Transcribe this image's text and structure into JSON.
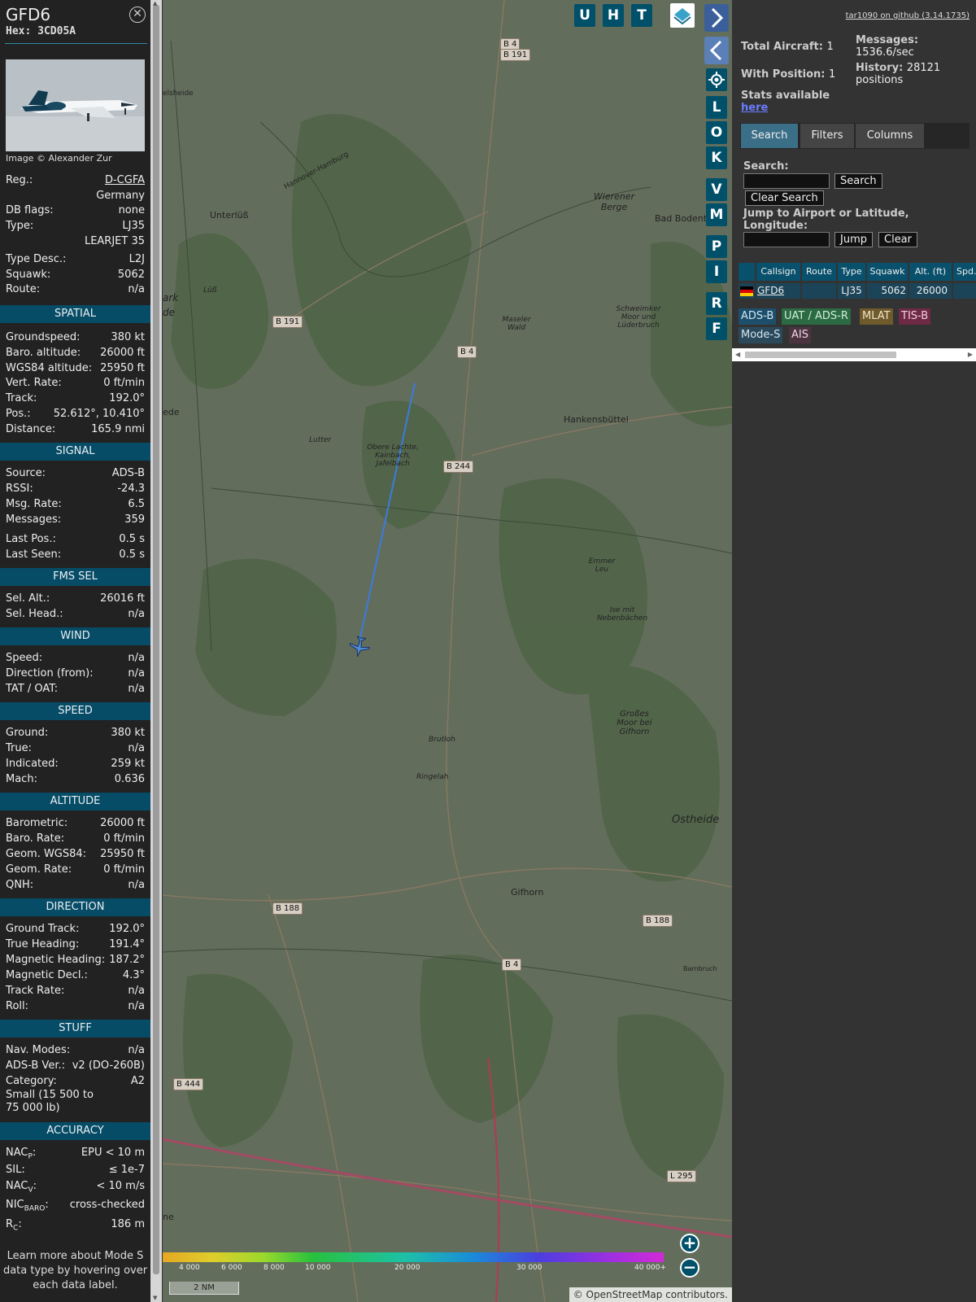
{
  "aircraft": {
    "callsign": "GFD6",
    "hex_label": "Hex:",
    "hex": "3CD05A",
    "image_credit": "Image © Alexander Zur"
  },
  "info": {
    "reg_label": "Reg.:",
    "reg": "D-CGFA",
    "country": "Germany",
    "dbflags_label": "DB flags:",
    "dbflags": "none",
    "type_label": "Type:",
    "type": "LJ35",
    "type_name": "LEARJET 35",
    "typedesc_label": "Type Desc.:",
    "typedesc": "L2J",
    "squawk_label": "Squawk:",
    "squawk": "5062",
    "route_label": "Route:",
    "route": "n/a"
  },
  "spatial": {
    "title": "SPATIAL",
    "rows": [
      {
        "k": "Groundspeed:",
        "v": "380 kt"
      },
      {
        "k": "Baro. altitude:",
        "v": "26000 ft"
      },
      {
        "k": "WGS84 altitude:",
        "v": "25950 ft"
      },
      {
        "k": "Vert. Rate:",
        "v": "0 ft/min"
      },
      {
        "k": "Track:",
        "v": "192.0°"
      },
      {
        "k": "Pos.:",
        "v": "52.612°, 10.410°"
      },
      {
        "k": "Distance:",
        "v": "165.9 nmi"
      }
    ]
  },
  "signal": {
    "title": "SIGNAL",
    "rows": [
      {
        "k": "Source:",
        "v": "ADS-B"
      },
      {
        "k": "RSSI:",
        "v": "-24.3"
      },
      {
        "k": "Msg. Rate:",
        "v": "6.5"
      },
      {
        "k": "Messages:",
        "v": "359"
      },
      {
        "k": "Last Pos.:",
        "v": "0.5 s"
      },
      {
        "k": "Last Seen:",
        "v": "0.5 s"
      }
    ]
  },
  "fms": {
    "title": "FMS SEL",
    "rows": [
      {
        "k": "Sel. Alt.:",
        "v": "26016 ft"
      },
      {
        "k": "Sel. Head.:",
        "v": "n/a"
      }
    ]
  },
  "wind": {
    "title": "WIND",
    "rows": [
      {
        "k": "Speed:",
        "v": "n/a"
      },
      {
        "k": "Direction (from):",
        "v": "n/a"
      },
      {
        "k": "TAT / OAT:",
        "v": "n/a"
      }
    ]
  },
  "speed": {
    "title": "SPEED",
    "rows": [
      {
        "k": "Ground:",
        "v": "380 kt"
      },
      {
        "k": "True:",
        "v": "n/a"
      },
      {
        "k": "Indicated:",
        "v": "259 kt"
      },
      {
        "k": "Mach:",
        "v": "0.636"
      }
    ]
  },
  "altitude": {
    "title": "ALTITUDE",
    "rows": [
      {
        "k": "Barometric:",
        "v": "26000 ft"
      },
      {
        "k": "Baro. Rate:",
        "v": "0 ft/min"
      },
      {
        "k": "Geom. WGS84:",
        "v": "25950 ft"
      },
      {
        "k": "Geom. Rate:",
        "v": "0 ft/min"
      },
      {
        "k": "QNH:",
        "v": "n/a"
      }
    ]
  },
  "direction": {
    "title": "DIRECTION",
    "rows": [
      {
        "k": "Ground Track:",
        "v": "192.0°"
      },
      {
        "k": "True Heading:",
        "v": "191.4°"
      },
      {
        "k": "Magnetic Heading:",
        "v": "187.2°"
      },
      {
        "k": "Magnetic Decl.:",
        "v": "4.3°"
      },
      {
        "k": "Track Rate:",
        "v": "n/a"
      },
      {
        "k": "Roll:",
        "v": "n/a"
      }
    ]
  },
  "stuff": {
    "title": "STUFF",
    "rows": [
      {
        "k": "Nav. Modes:",
        "v": "n/a"
      },
      {
        "k": "ADS-B Ver.:",
        "v": "v2 (DO-260B)"
      },
      {
        "k": "Category:",
        "v": "A2"
      }
    ],
    "category_desc_1": "Small (15 500 to",
    "category_desc_2": "75 000 lb)"
  },
  "accuracy": {
    "title": "ACCURACY",
    "nacp_label": "NAC",
    "nacp_sub": "P",
    "nacp": "EPU < 10 m",
    "sil_label": "SIL:",
    "sil": "≤ 1e-7",
    "nacv_label": "NAC",
    "nacv_sub": "V",
    "nacv": "< 10 m/s",
    "nicbaro_label": "NIC",
    "nicbaro_sub": "BARO",
    "nicbaro": "cross-checked",
    "rc_label": "R",
    "rc_sub": "C",
    "rc": "186 m"
  },
  "footer_note": [
    "Learn more about Mode S",
    "data type by hovering over",
    "each data label."
  ],
  "map": {
    "top_buttons": [
      "U",
      "H",
      "T"
    ],
    "side_buttons": [
      "L",
      "O",
      "K",
      "V",
      "M",
      "P",
      "I",
      "R",
      "F"
    ],
    "places": [
      "Unterlüß",
      "Wierener Berge",
      "Bad Bodente",
      "Maseler Wald",
      "Hankensbüttel",
      "Schweimker Moor und Lüderbruch",
      "Lutter",
      "Obere Lachte, Kainbach, Jafelbach",
      "Emmer Leu",
      "Ise mit Nebenbächen",
      "Großes Moor bei Gifhorn",
      "Brutloh",
      "Ringelah",
      "Ostheide",
      "Gifhorn",
      "Barnbruch",
      "Hannover-Hamburg",
      "Lüß",
      "ark de",
      "ede",
      "elsheide",
      "ne"
    ],
    "roads": [
      "B 4",
      "B 191",
      "B 191",
      "B 4",
      "B 244",
      "B 188",
      "B 188",
      "B 4",
      "B 444",
      "L 295"
    ],
    "color_scale": [
      "4 000",
      "6 000",
      "8 000",
      "10 000",
      "20 000",
      "30 000",
      "40 000+"
    ],
    "scale_bar": "2 NM",
    "attribution": "© OpenStreetMap contributors."
  },
  "panel": {
    "github_link": "tar1090 on github (3.14.1735)",
    "total_aircraft_label": "Total Aircraft:",
    "total_aircraft": "1",
    "with_position_label": "With Position:",
    "with_position": "1",
    "messages_label": "Messages:",
    "messages": "1536.6/sec",
    "history_label": "History:",
    "history_1": "28121",
    "history_2": "positions",
    "stats_label": "Stats available",
    "stats_link": "here",
    "tabs": [
      "Search",
      "Filters",
      "Columns"
    ],
    "search_label": "Search:",
    "search_button": "Search",
    "clear_search_button": "Clear Search",
    "jump_label_1": "Jump to Airport or Latitude,",
    "jump_label_2": "Longitude:",
    "jump_button": "Jump",
    "clear_button": "Clear",
    "columns": [
      "Callsign",
      "Route",
      "Type",
      "Squawk",
      "Alt. (ft)",
      "Spd."
    ],
    "table_row": {
      "callsign": "GFD6",
      "route": "",
      "type": "LJ35",
      "squawk": "5062",
      "alt": "26000"
    },
    "source_tags": [
      "ADS-B",
      "UAT / ADS-R",
      "MLAT",
      "TIS-B",
      "Mode-S",
      "AIS"
    ],
    "colors": {
      "adsb": "#1d4e6b",
      "uat": "#2c6a44",
      "mlat": "#6f5a2c",
      "tisb": "#6e2a45",
      "modes": "#2a4a5c"
    }
  }
}
